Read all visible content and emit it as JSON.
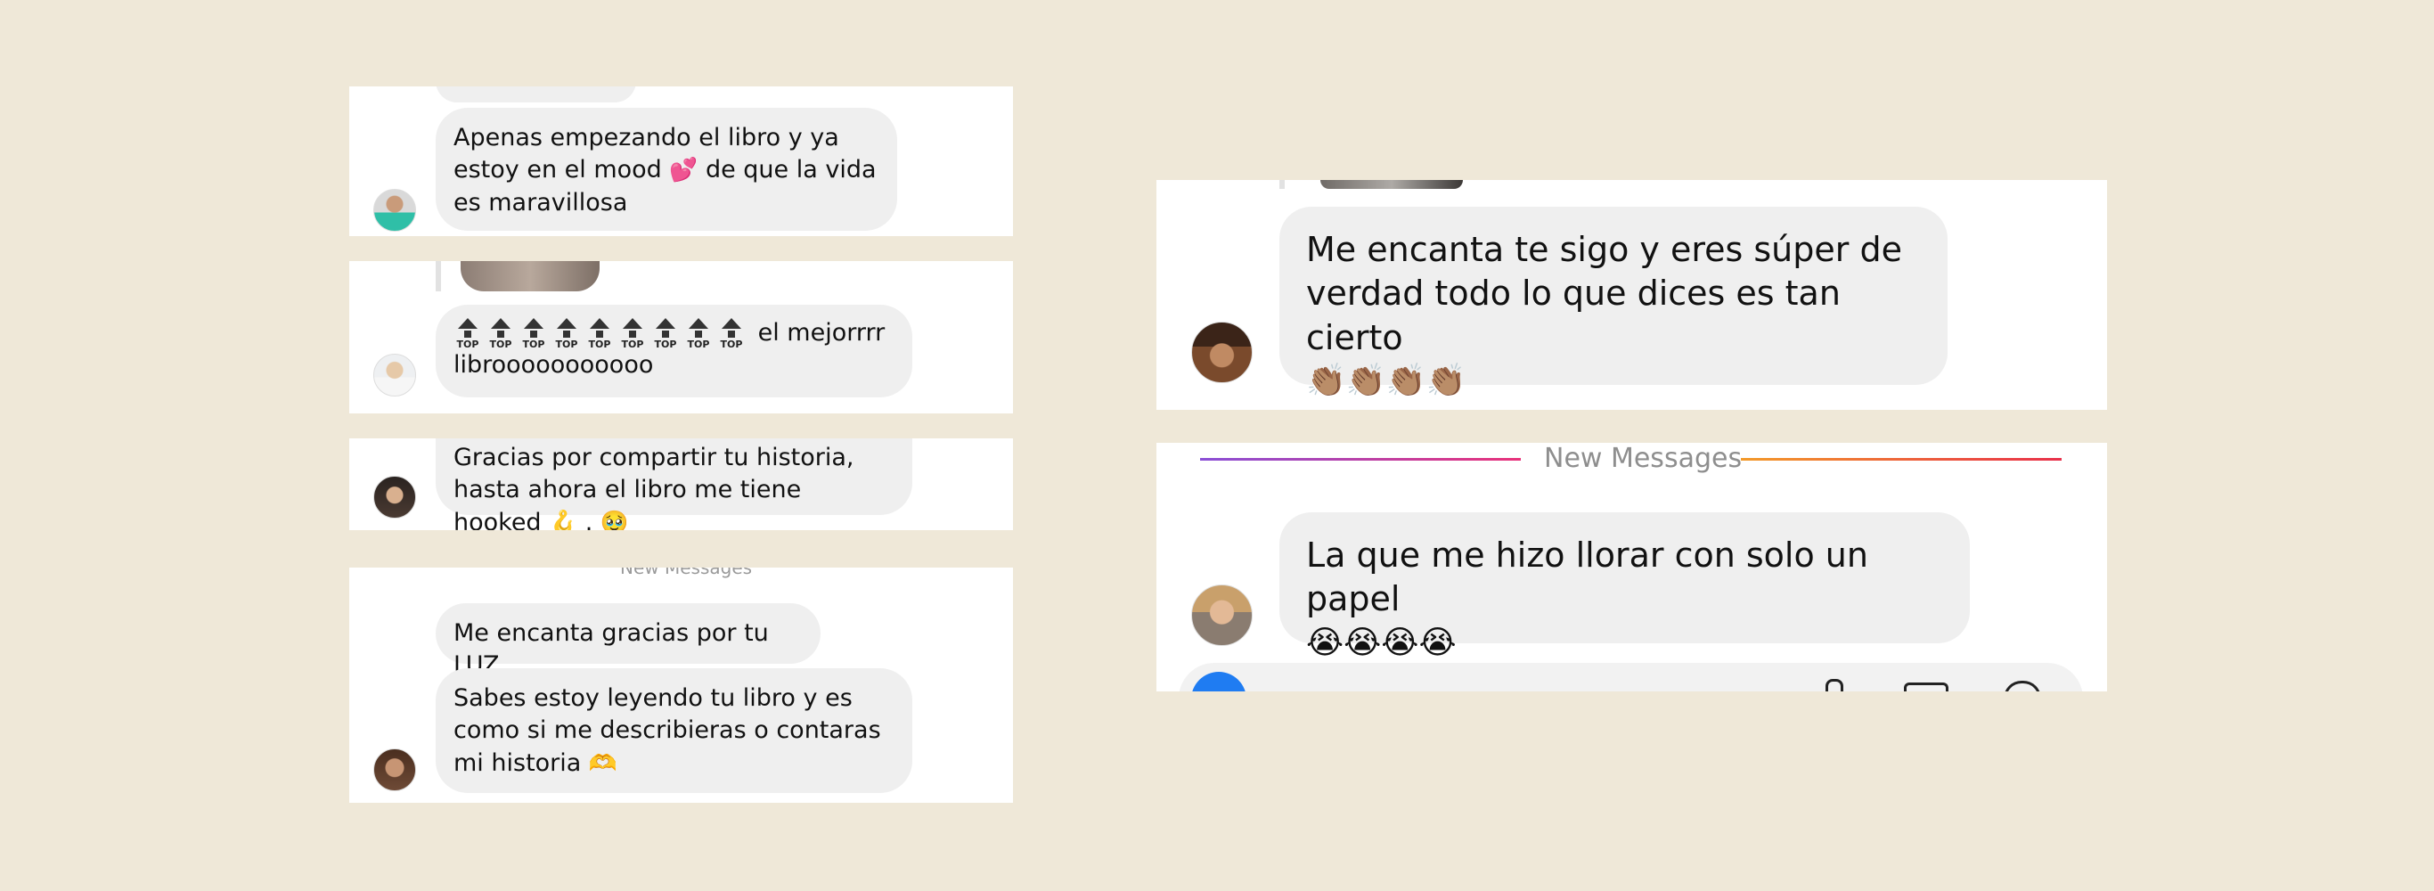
{
  "left": {
    "msg1": {
      "text_a": "Apenas empezando el libro y ya estoy en el mood",
      "emoji": "💕",
      "text_b": "de que la vida es maravillosa"
    },
    "msg2": {
      "top_label": "TOP",
      "text": "el mejorrrr librooooooooooo"
    },
    "msg3": {
      "text_a": "Gracias por compartir tu historia, hasta ahora el libro me tiene hooked",
      "emoji_a": "🪝",
      "sep": ".",
      "emoji_b": "🥹"
    },
    "msg4": {
      "new_messages": "New Messages",
      "bubble1": "Me encanta gracias por tu LUZ",
      "bubble2": "Sabes estoy leyendo tu libro y es como si me describieras o contaras mi historia",
      "emoji": "🫶"
    }
  },
  "right": {
    "msg5": {
      "text": "Me encanta te sigo y eres súper de verdad todo lo que dices es tan cierto",
      "emojis": "👏🏽👏🏽👏🏽👏🏽"
    },
    "msg6": {
      "new_messages": "New Messages",
      "text": "La que me hizo llorar con solo un papel",
      "emojis": "😭😭😭😭"
    }
  },
  "colors": {
    "background": "#efe8d8",
    "bubble": "#efefef",
    "compose_blue": "#1f7cf2",
    "new_messages_gradient_left": [
      "#8a4fd6",
      "#e8327a"
    ],
    "new_messages_gradient_right": [
      "#f39a2a",
      "#e8304a"
    ]
  },
  "icons": [
    "avatar-woman-teal",
    "avatar-woman-light",
    "avatar-woman-dark-hair",
    "avatar-woman-curly",
    "avatar-man-hat",
    "avatar-woman-blonde",
    "camera-icon"
  ]
}
